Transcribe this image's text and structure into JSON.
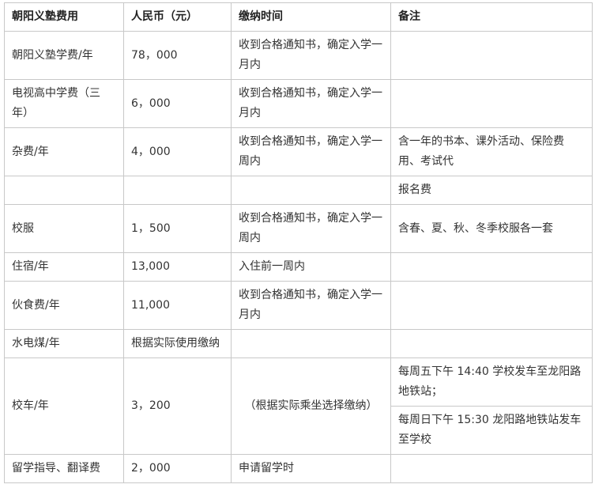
{
  "table": {
    "headers": [
      "朝阳义塾费用",
      "人民币（元）",
      "缴纳时间",
      "备注"
    ],
    "rows": [
      [
        "朝阳义塾学费/年",
        "78，000",
        "收到合格通知书，确定入学一月内",
        ""
      ],
      [
        "电视高中学费（三年）",
        "6，000",
        "收到合格通知书，确定入学一月内",
        ""
      ],
      [
        "杂费/年",
        "4，000",
        "收到合格通知书，确定入学一周内",
        "含一年的书本、课外活动、保险费用、考试代"
      ],
      [
        "",
        "",
        "",
        "报名费"
      ],
      [
        "校服",
        "1，500",
        "收到合格通知书，确定入学一周内",
        "含春、夏、秋、冬季校服各一套"
      ],
      [
        "住宿/年",
        "13,000",
        "入住前一周内",
        ""
      ],
      [
        "伙食费/年",
        "11,000",
        "收到合格通知书，确定入学一月内",
        ""
      ],
      [
        "水电煤/年",
        "根据实际使用缴纳",
        "",
        ""
      ],
      [
        "校车/年",
        "3，200",
        "（根据实际乘坐选择缴纳）",
        "每周五下午 14:40 学校发车至龙阳路地铁站；"
      ],
      [
        "",
        "",
        "",
        "每周日下午 15:30 龙阳路地铁站发车至学校"
      ],
      [
        "留学指导、翻译费",
        "2，000",
        "申请留学时",
        ""
      ]
    ]
  }
}
